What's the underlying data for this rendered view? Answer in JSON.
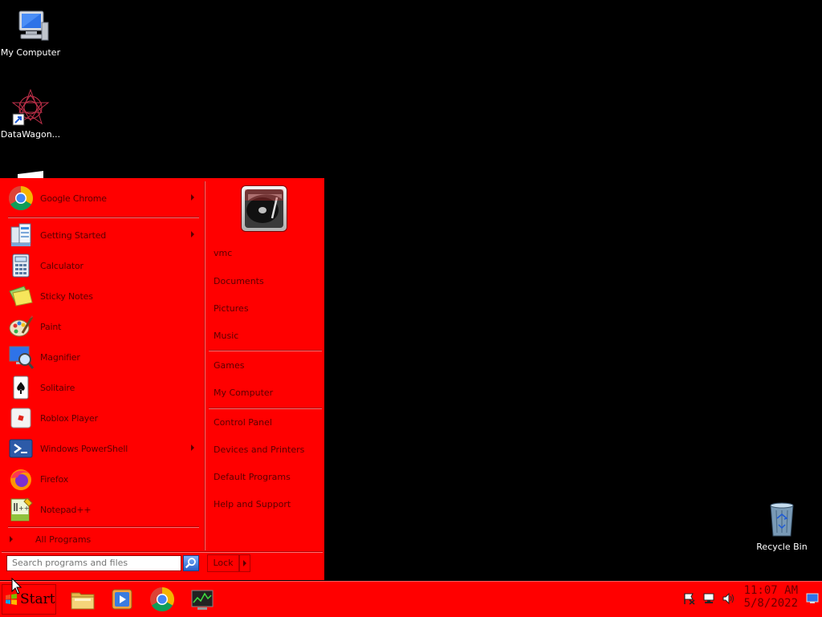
{
  "desktop": {
    "icons": [
      {
        "label": "My Computer",
        "icon": "computer-icon"
      },
      {
        "label": "DataWagon...",
        "icon": "datawagon-shortcut-icon"
      },
      {
        "label": "Recycle Bin",
        "icon": "recycle-bin-icon"
      }
    ]
  },
  "start_menu": {
    "pinned": [
      {
        "label": "Google Chrome",
        "icon": "chrome-icon",
        "has_submenu": true
      }
    ],
    "recent": [
      {
        "label": "Getting Started",
        "icon": "getting-started-icon",
        "has_submenu": true
      },
      {
        "label": "Calculator",
        "icon": "calculator-icon",
        "has_submenu": false
      },
      {
        "label": "Sticky Notes",
        "icon": "sticky-notes-icon",
        "has_submenu": false
      },
      {
        "label": "Paint",
        "icon": "paint-icon",
        "has_submenu": false
      },
      {
        "label": "Magnifier",
        "icon": "magnifier-icon",
        "has_submenu": false
      },
      {
        "label": "Solitaire",
        "icon": "solitaire-icon",
        "has_submenu": false
      },
      {
        "label": "Roblox Player",
        "icon": "roblox-icon",
        "has_submenu": false
      },
      {
        "label": "Windows PowerShell",
        "icon": "powershell-icon",
        "has_submenu": true
      },
      {
        "label": "Firefox",
        "icon": "firefox-icon",
        "has_submenu": false
      },
      {
        "label": "Notepad++",
        "icon": "notepadpp-icon",
        "has_submenu": false
      }
    ],
    "all_programs": "All Programs",
    "right": {
      "group1": [
        "vmc",
        "Documents",
        "Pictures",
        "Music"
      ],
      "group2": [
        "Games",
        "My Computer"
      ],
      "group3": [
        "Control Panel",
        "Devices and Printers",
        "Default Programs",
        "Help and Support"
      ]
    },
    "search_placeholder": "Search programs and files",
    "lock_label": "Lock"
  },
  "taskbar": {
    "start_label": "Start",
    "pinned": [
      "explorer-icon",
      "media-player-icon",
      "chrome-icon",
      "task-manager-icon"
    ],
    "clock_time": "11:07 AM",
    "clock_date": "5/8/2022"
  },
  "colors": {
    "accent": "#ff0000",
    "text_dark": "#5a0000"
  }
}
